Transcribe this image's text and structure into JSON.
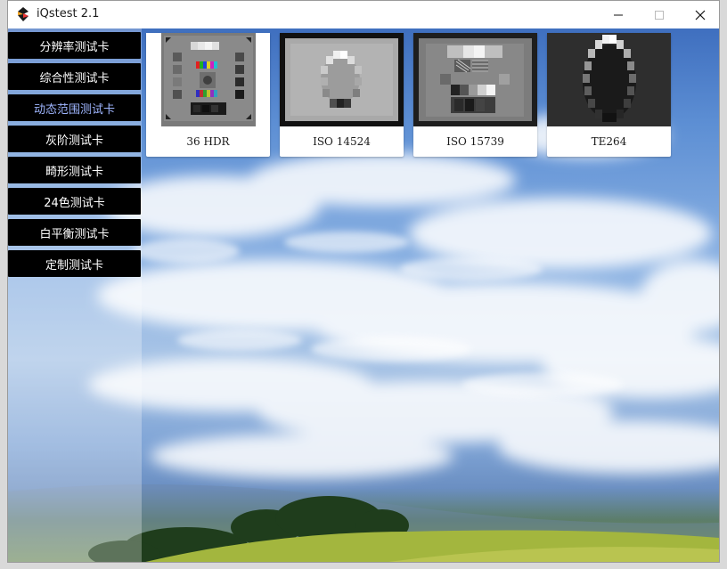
{
  "window": {
    "title": "iQstest 2.1"
  },
  "title_controls": {
    "minimize_icon": "minimize-icon",
    "maximize_icon": "maximize-icon",
    "close_icon": "close-icon"
  },
  "sidebar": {
    "items": [
      {
        "label": "分辨率测试卡",
        "active": false
      },
      {
        "label": "综合性测试卡",
        "active": false
      },
      {
        "label": "动态范围测试卡",
        "active": true
      },
      {
        "label": "灰阶测试卡",
        "active": false
      },
      {
        "label": "畸形测试卡",
        "active": false
      },
      {
        "label": "24色测试卡",
        "active": false
      },
      {
        "label": "白平衡测试卡",
        "active": false
      },
      {
        "label": "定制测试卡",
        "active": false
      }
    ]
  },
  "cards": [
    {
      "label": "36 HDR"
    },
    {
      "label": "ISO 14524"
    },
    {
      "label": "ISO 15739"
    },
    {
      "label": "TE264"
    }
  ],
  "colors": {
    "active_text": "#9fb6ff",
    "button_bg": "#000000",
    "sky": "#5d8fd4",
    "field": "#9bb83c"
  }
}
